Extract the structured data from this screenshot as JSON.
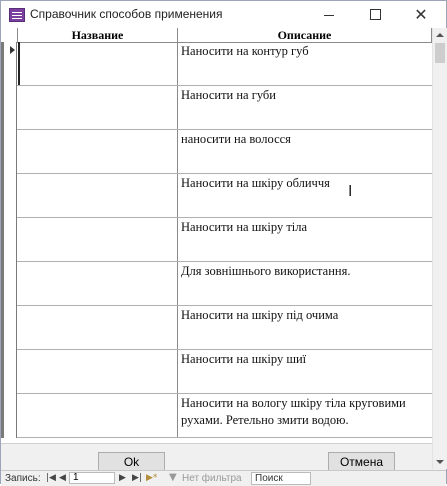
{
  "window": {
    "title": "Справочник способов применения",
    "minimize_icon": "minimize-icon",
    "maximize_icon": "maximize-icon",
    "close_icon": "close-icon",
    "close_glyph": "✕"
  },
  "grid": {
    "columns": [
      "Название",
      "Описание"
    ],
    "rows": [
      {
        "name": "",
        "description": "Наносити на контур губ"
      },
      {
        "name": "",
        "description": "Наносити на губи"
      },
      {
        "name": "",
        "description": "наносити на волосся"
      },
      {
        "name": "",
        "description": "Наносити на шкіру обличчя"
      },
      {
        "name": "",
        "description": "Наносити на шкіру тіла"
      },
      {
        "name": "",
        "description": "Для зовнішнього використання."
      },
      {
        "name": "",
        "description": "Наносити на шкіру під очима"
      },
      {
        "name": "",
        "description": "Наносити на шкіру шиї"
      },
      {
        "name": "",
        "description": "Наносити на вологу шкіру тіла круговими рухами. Ретельно змити водою."
      }
    ]
  },
  "buttons": {
    "ok_label": "Ok",
    "cancel_label": "Отмена"
  },
  "navigation": {
    "record_label": "Запись:",
    "current_record": "1",
    "first_glyph": "|◀",
    "prev_glyph": "◀",
    "next_glyph": "▶",
    "last_glyph": "▶|",
    "new_glyph": "▶*",
    "filter_icon_glyph": "▼",
    "filter_text": "Нет фильтра",
    "search_placeholder": "Поиск"
  },
  "colors": {
    "title_icon": "#7b3fa0",
    "window_bg": "#f0f0f0",
    "grid_bg": "#ffffff"
  }
}
